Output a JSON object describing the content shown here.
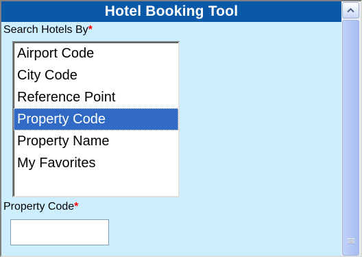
{
  "header": {
    "title": "Hotel Booking Tool"
  },
  "search": {
    "label": "Search Hotels By",
    "required_marker": "*",
    "options": [
      "Airport Code",
      "City Code",
      "Reference Point",
      "Property Code",
      "Property Name",
      "My Favorites"
    ],
    "selected": "Property Code"
  },
  "property_code": {
    "label": "Property  Code",
    "required_marker": "*",
    "value": ""
  },
  "scrollbar": {
    "up_icon": "arrow-up-icon",
    "grip_icon": "grip-icon"
  },
  "colors": {
    "title_bar": "#0a58a8",
    "panel_bg": "#cdeffd",
    "selection": "#316ac5",
    "required": "#ff0000"
  }
}
